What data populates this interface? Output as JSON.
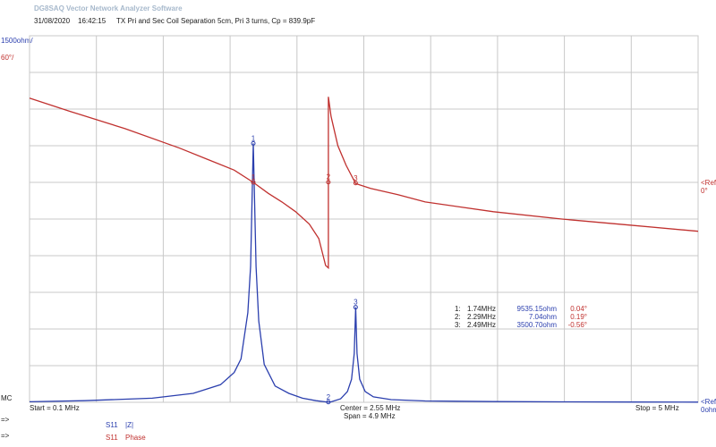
{
  "app": {
    "title": "DG8SAQ Vector Network Analyzer Software",
    "date": "31/08/2020",
    "time": "16:42:15",
    "description": "TX Pri and Sec Coil Separation 5cm, Pri 3 turns, Cp = 839.9pF"
  },
  "axes": {
    "left_top_blue": "1500ohm/",
    "left_top_red": "60°/",
    "left_bottom": "MC",
    "right_ref2_label": "<Ref2",
    "right_ref2_value": "0°",
    "right_ref1_label": "<Ref1",
    "right_ref1_value": "0ohm",
    "start": "Start = 0.1 MHz",
    "center": "Center = 2.55 MHz",
    "span": "Span = 4.9 MHz",
    "stop": "Stop = 5 MHz",
    "left_arrow_1": "=>",
    "left_arrow_2": "=>"
  },
  "legend": [
    {
      "trace": "S11",
      "name": "|Z|",
      "color": "#2b3fae"
    },
    {
      "trace": "S11",
      "name": "Phase",
      "color": "#c0312f"
    }
  ],
  "markers": [
    {
      "id": "1:",
      "freq": "1.74MHz",
      "z": "9535.15ohm",
      "phase": "0.04°",
      "freq_mhz": 1.74,
      "z_ohm": 9535.15,
      "phase_deg": 0.04
    },
    {
      "id": "2:",
      "freq": "2.29MHz",
      "z": "7.04ohm",
      "phase": "0.19°",
      "freq_mhz": 2.29,
      "z_ohm": 7.04,
      "phase_deg": 0.19
    },
    {
      "id": "3:",
      "freq": "2.49MHz",
      "z": "3500.70ohm",
      "phase": "-0.56°",
      "freq_mhz": 2.49,
      "z_ohm": 3500.7,
      "phase_deg": -0.56
    }
  ],
  "chart_data": {
    "type": "line",
    "xlabel": "",
    "x_unit": "MHz",
    "xlim": [
      0.1,
      5.0
    ],
    "grid": true,
    "series": [
      {
        "name": "S11 |Z|",
        "axis": "impedance_ohm",
        "color": "#2b3fae",
        "x": [
          0.1,
          0.5,
          1.0,
          1.3,
          1.5,
          1.6,
          1.65,
          1.7,
          1.72,
          1.74,
          1.76,
          1.78,
          1.82,
          1.9,
          2.0,
          2.1,
          2.2,
          2.27,
          2.29,
          2.31,
          2.38,
          2.43,
          2.46,
          2.48,
          2.49,
          2.5,
          2.52,
          2.56,
          2.62,
          2.75,
          3.0,
          3.5,
          4.0,
          4.5,
          5.0
        ],
        "y": [
          20,
          60,
          150,
          330,
          650,
          1100,
          1600,
          3300,
          5000,
          9535,
          5000,
          3000,
          1400,
          600,
          330,
          150,
          60,
          15,
          7,
          15,
          130,
          400,
          850,
          1800,
          3500,
          1800,
          850,
          400,
          200,
          100,
          50,
          25,
          15,
          10,
          5
        ]
      },
      {
        "name": "S11 Phase",
        "axis": "phase_deg",
        "color": "#c0312f",
        "x": [
          0.1,
          0.4,
          0.8,
          1.2,
          1.4,
          1.6,
          1.74,
          1.85,
          1.95,
          2.05,
          2.15,
          2.22,
          2.27,
          2.29,
          2.29,
          2.31,
          2.36,
          2.42,
          2.49,
          2.6,
          2.8,
          3.0,
          3.5,
          4.0,
          4.5,
          5.0
        ],
        "y": [
          69,
          58,
          44,
          28,
          19,
          10,
          0,
          -9,
          -16,
          -24,
          -34,
          -46,
          -68,
          -70,
          70,
          54,
          30,
          14,
          -1,
          -5,
          -10,
          -16,
          -24,
          -30,
          -35,
          -40
        ]
      }
    ],
    "y_left_impedance": {
      "scale": "1500ohm/div",
      "ref": "0ohm",
      "lim": [
        0,
        13500
      ]
    },
    "y_left_phase": {
      "scale": "60°/div",
      "ref": "0°",
      "lim": [
        -180,
        120
      ]
    }
  },
  "colors": {
    "grid": "#c8c8c8",
    "blue": "#2b3fae",
    "red": "#c0312f"
  }
}
